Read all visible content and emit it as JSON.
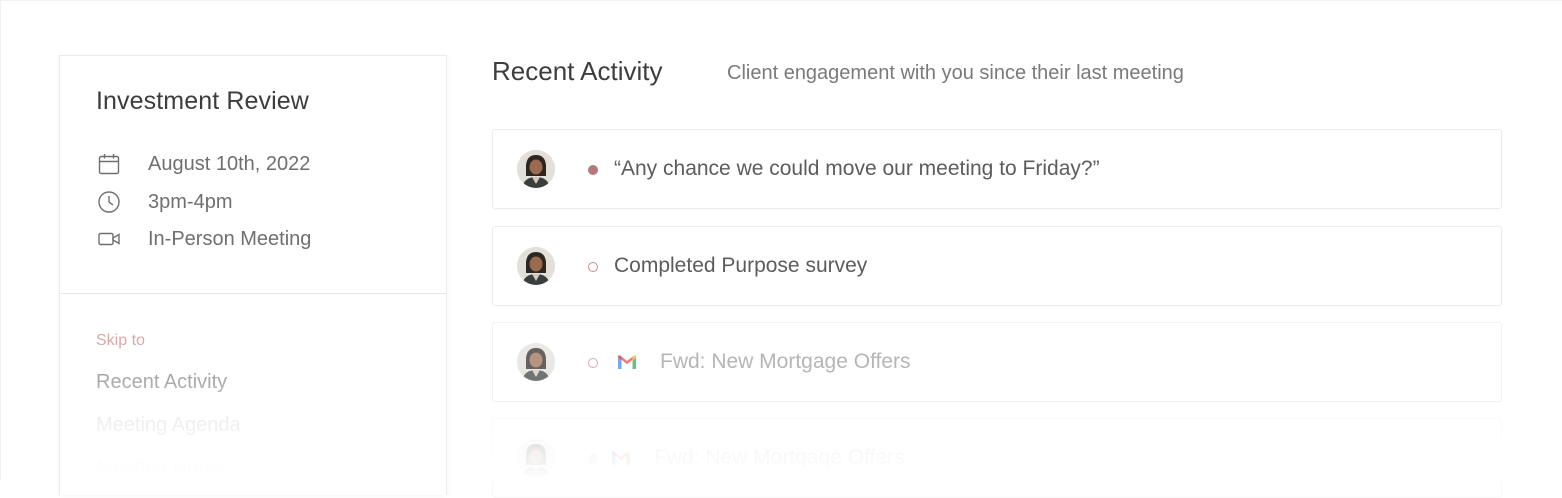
{
  "meeting": {
    "title": "Investment Review",
    "date": "August 10th, 2022",
    "time": "3pm-4pm",
    "type": "In-Person Meeting",
    "icons": {
      "date": "calendar-icon",
      "time": "clock-icon",
      "type": "video-camera-icon"
    }
  },
  "skip": {
    "label": "Skip to",
    "links": [
      "Recent Activity",
      "Meeting Agenda",
      "Meeting Notes"
    ]
  },
  "recent_activity": {
    "title": "Recent Activity",
    "subtitle": "Client engagement with you since their last meeting",
    "items": [
      {
        "text": "“Any chance we could move our meeting to Friday?”",
        "status": "filled",
        "icon": ""
      },
      {
        "text": "Completed Purpose survey",
        "status": "hollow",
        "icon": ""
      },
      {
        "text": "Fwd: New Mortgage Offers",
        "status": "hollow",
        "icon": "gmail-icon"
      },
      {
        "text": "Fwd: New Mortgage Offers",
        "status": "filled",
        "icon": "gmail-icon"
      }
    ]
  },
  "colors": {
    "accent_dot": "#b5777a",
    "skip_label": "#d8a8a8",
    "title_text": "#3d3d3d"
  }
}
